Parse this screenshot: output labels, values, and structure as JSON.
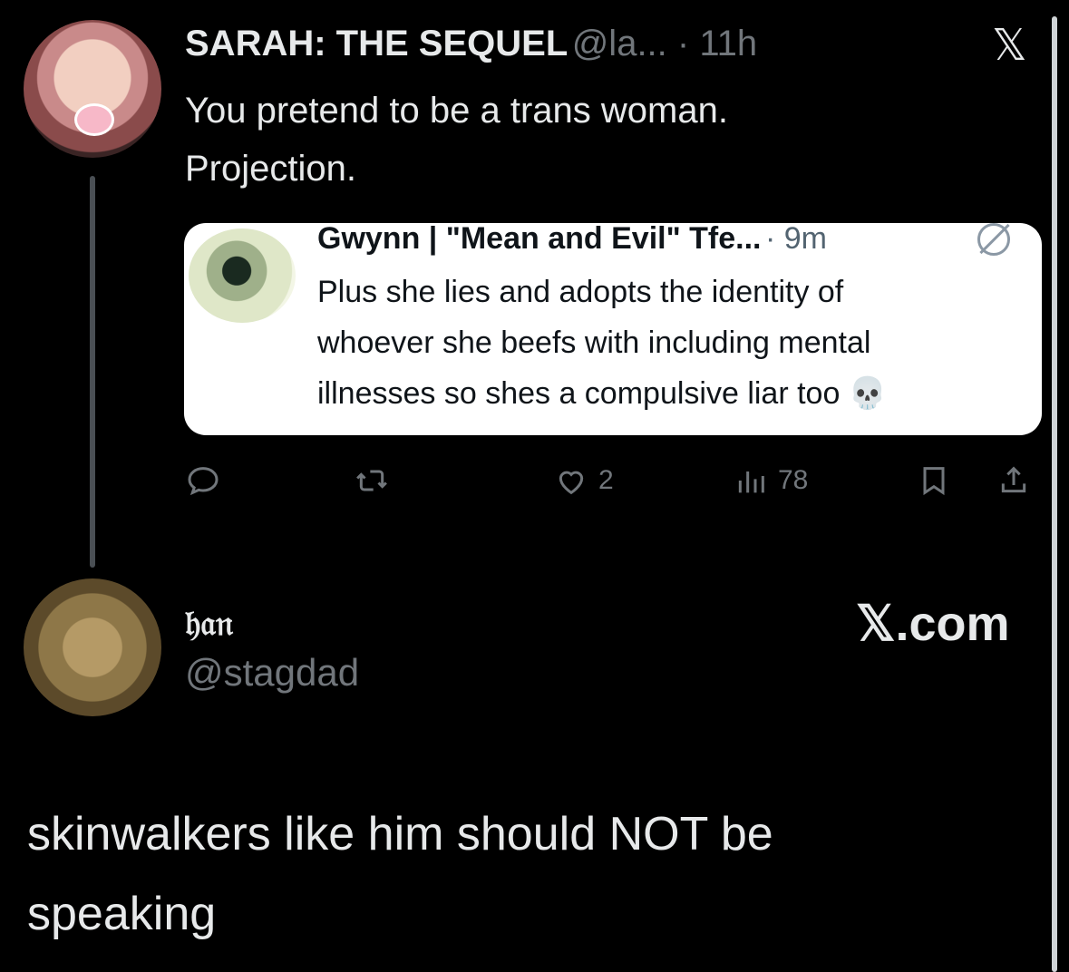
{
  "tweet": {
    "author_name": "SARAH: THE SEQUEL",
    "handle_time": "@la... · 11h",
    "text_line1": "You pretend to be a trans woman.",
    "text_line2": "Projection.",
    "x_logo": "𝕏",
    "quoted": {
      "author_name": "Gwynn | \"Mean and Evil\" Tfe...",
      "time": "· 9m",
      "line1": "Plus she lies and adopts the identity of",
      "line2": "whoever she beefs with including mental",
      "line3": "illnesses so shes a compulsive liar too 💀"
    },
    "actions": {
      "likes": "2",
      "views": "78"
    }
  },
  "footer_card": {
    "name": "𝔥𝔞𝔫",
    "handle": "@stagdad",
    "site": "𝕏.com"
  },
  "caption": {
    "line1": "skinwalkers like him should NOT be",
    "line2": "speaking"
  },
  "icons": [
    "reply-icon",
    "retweet-icon",
    "like-icon",
    "views-icon",
    "bookmark-icon",
    "share-icon",
    "x-logo-icon",
    "quote-tweet-icon"
  ],
  "colors": {
    "background": "#000000",
    "text": "#e7e9ea",
    "muted": "#71767b"
  }
}
